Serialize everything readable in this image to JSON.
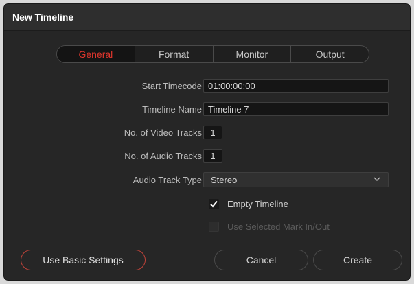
{
  "dialog": {
    "title": "New Timeline"
  },
  "tabs": [
    {
      "label": "General",
      "active": true
    },
    {
      "label": "Format",
      "active": false
    },
    {
      "label": "Monitor",
      "active": false
    },
    {
      "label": "Output",
      "active": false
    }
  ],
  "form": {
    "start_timecode": {
      "label": "Start Timecode",
      "value": "01:00:00:00"
    },
    "timeline_name": {
      "label": "Timeline Name",
      "value": "Timeline 7"
    },
    "video_tracks": {
      "label": "No. of Video Tracks",
      "value": "1"
    },
    "audio_tracks": {
      "label": "No. of Audio Tracks",
      "value": "1"
    },
    "audio_track_type": {
      "label": "Audio Track Type",
      "value": "Stereo",
      "icon": "chevron-down-icon"
    },
    "empty_timeline": {
      "label": "Empty Timeline",
      "checked": true,
      "icon": "checkmark-icon"
    },
    "use_selected_mark": {
      "label": "Use Selected Mark In/Out",
      "checked": false,
      "disabled": true
    }
  },
  "footer": {
    "basic_settings_label": "Use Basic Settings",
    "cancel_label": "Cancel",
    "create_label": "Create"
  },
  "colors": {
    "accent": "#e0362d",
    "background": "#262626",
    "field": "#151515"
  }
}
